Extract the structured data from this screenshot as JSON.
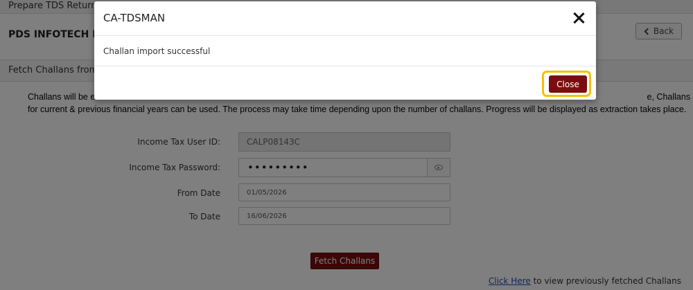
{
  "app": {
    "title": "Prepare TDS Return"
  },
  "header": {
    "company": "PDS INFOTECH PVT",
    "back_label": "Back"
  },
  "section": {
    "title": "Fetch Challans from"
  },
  "info": {
    "line1": "Challans will be ex                                                                                                                                                                                                                              e, Challans only",
    "line1_left": "Challans will be ex",
    "line1_right": "e, Challans only",
    "line2": "for current & previous financial years can be used. The process may take time depending upon the number of challans. Progress will be displayed as extraction takes place."
  },
  "form": {
    "user_id_label": "Income Tax User ID:",
    "user_id_value": "CALP08143C",
    "password_label": "Income Tax Password:",
    "password_value": "•••••••••",
    "from_date_label": "From Date",
    "from_date_value": "01/05/2026",
    "to_date_label": "To Date",
    "to_date_value": "16/06/2026"
  },
  "actions": {
    "fetch_label": "Fetch Challans"
  },
  "footer": {
    "link_text": "Click Here",
    "rest_text": " to view previously fetched Challans"
  },
  "modal": {
    "title": "CA-TDSMAN",
    "message": "Challan import successful",
    "close_label": "Close"
  },
  "colors": {
    "accent": "#7a0e0e",
    "highlight": "#f2c200",
    "link": "#1a4fb5"
  },
  "icons": [
    "chevron-left-icon",
    "eye-icon",
    "close-icon"
  ]
}
